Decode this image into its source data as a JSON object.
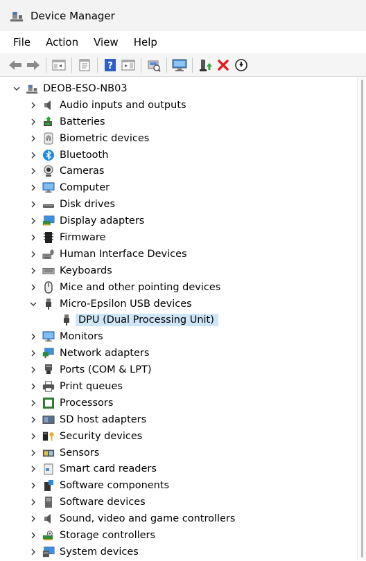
{
  "window": {
    "title": "Device Manager"
  },
  "menu": [
    "File",
    "Action",
    "View",
    "Help"
  ],
  "toolbar": {
    "buttons": [
      "back",
      "forward",
      "show-hide-console-tree",
      "properties",
      "help",
      "action-pane",
      "scan-hardware",
      "computer-view",
      "enable-device",
      "uninstall-device",
      "update-driver"
    ]
  },
  "tree": {
    "root": "DEOB-ESO-NB03",
    "categories": [
      {
        "label": "Audio inputs and outputs",
        "icon": "speaker-icon",
        "expanded": false
      },
      {
        "label": "Batteries",
        "icon": "battery-icon",
        "expanded": false
      },
      {
        "label": "Biometric devices",
        "icon": "fingerprint-icon",
        "expanded": false
      },
      {
        "label": "Bluetooth",
        "icon": "bluetooth-icon",
        "expanded": false
      },
      {
        "label": "Cameras",
        "icon": "camera-icon",
        "expanded": false
      },
      {
        "label": "Computer",
        "icon": "monitor-icon",
        "expanded": false
      },
      {
        "label": "Disk drives",
        "icon": "disk-drive-icon",
        "expanded": false
      },
      {
        "label": "Display adapters",
        "icon": "display-adapter-icon",
        "expanded": false
      },
      {
        "label": "Firmware",
        "icon": "chip-icon",
        "expanded": false
      },
      {
        "label": "Human Interface Devices",
        "icon": "hid-icon",
        "expanded": false
      },
      {
        "label": "Keyboards",
        "icon": "keyboard-icon",
        "expanded": false
      },
      {
        "label": "Mice and other pointing devices",
        "icon": "mouse-icon",
        "expanded": false
      },
      {
        "label": "Micro-Epsilon USB devices",
        "icon": "usb-plug-icon",
        "expanded": true,
        "children": [
          "DPU (Dual Processing Unit)"
        ]
      },
      {
        "label": "Monitors",
        "icon": "monitor-icon",
        "expanded": false
      },
      {
        "label": "Network adapters",
        "icon": "network-icon",
        "expanded": false
      },
      {
        "label": "Ports (COM & LPT)",
        "icon": "port-icon",
        "expanded": false
      },
      {
        "label": "Print queues",
        "icon": "printer-icon",
        "expanded": false
      },
      {
        "label": "Processors",
        "icon": "processor-icon",
        "expanded": false
      },
      {
        "label": "SD host adapters",
        "icon": "sd-card-icon",
        "expanded": false
      },
      {
        "label": "Security devices",
        "icon": "security-key-icon",
        "expanded": false
      },
      {
        "label": "Sensors",
        "icon": "sensor-icon",
        "expanded": false
      },
      {
        "label": "Smart card readers",
        "icon": "smart-card-icon",
        "expanded": false
      },
      {
        "label": "Software components",
        "icon": "software-component-icon",
        "expanded": false
      },
      {
        "label": "Software devices",
        "icon": "software-device-icon",
        "expanded": false
      },
      {
        "label": "Sound, video and game controllers",
        "icon": "speaker-icon",
        "expanded": false
      },
      {
        "label": "Storage controllers",
        "icon": "storage-controller-icon",
        "expanded": false
      },
      {
        "label": "System devices",
        "icon": "system-devices-icon",
        "expanded": false
      }
    ]
  },
  "colors": {
    "selection": "#cfe6f7",
    "accent": "#1e88e5",
    "danger": "#e01e1e"
  }
}
